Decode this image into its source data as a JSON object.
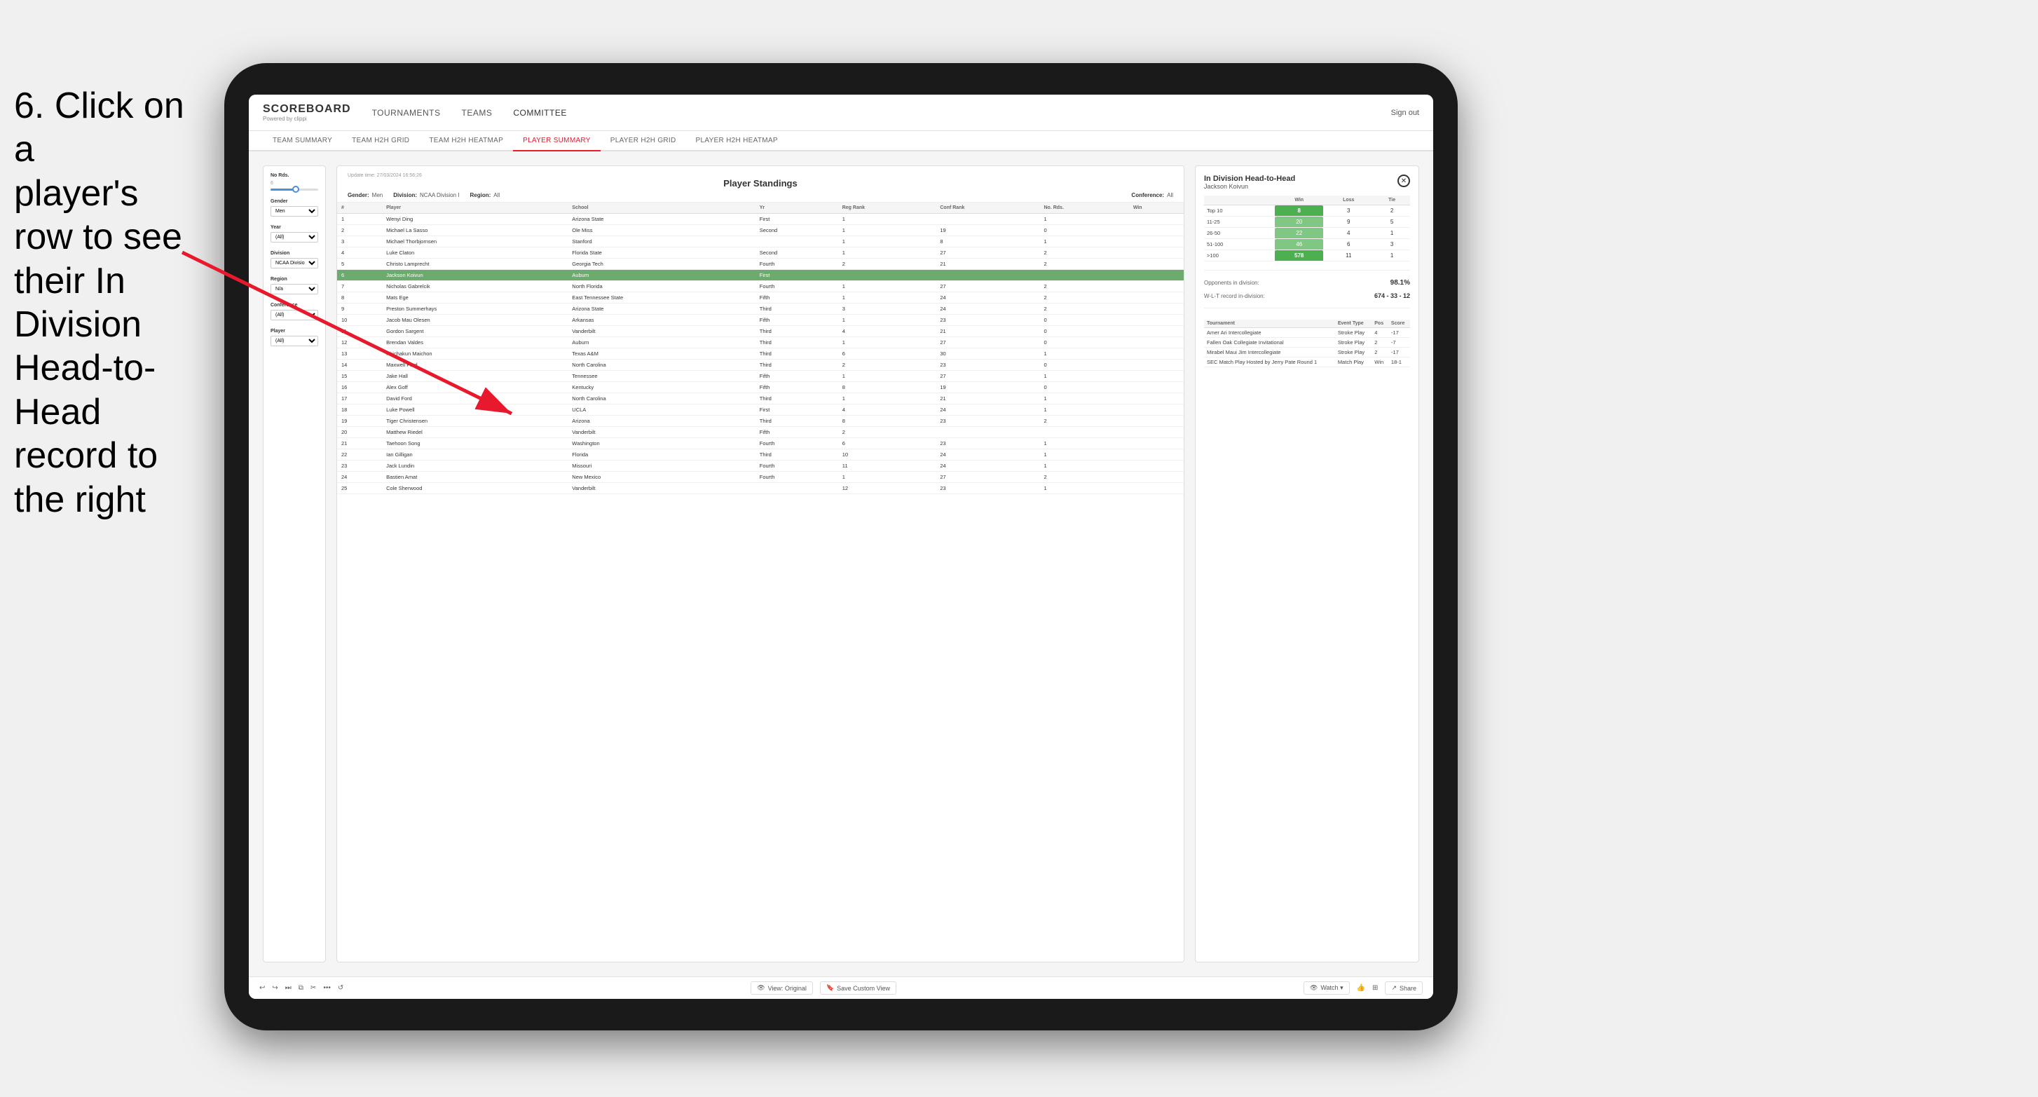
{
  "instruction": {
    "line1": "6. Click on a",
    "line2": "player's row to see",
    "line3": "their In Division",
    "line4": "Head-to-Head",
    "line5": "record to the right"
  },
  "nav": {
    "logo": "SCOREBOARD",
    "logo_sub": "Powered by clippi",
    "items": [
      "TOURNAMENTS",
      "TEAMS",
      "COMMITTEE"
    ],
    "sign_out": "Sign out"
  },
  "sub_nav": {
    "items": [
      "TEAM SUMMARY",
      "TEAM H2H GRID",
      "TEAM H2H HEATMAP",
      "PLAYER SUMMARY",
      "PLAYER H2H GRID",
      "PLAYER H2H HEATMAP"
    ],
    "active": "PLAYER SUMMARY"
  },
  "filters": {
    "no_rds_label": "No Rds.",
    "no_rds_value": "6",
    "gender_label": "Gender",
    "gender_value": "Men",
    "year_label": "Year",
    "year_value": "(All)",
    "division_label": "Division",
    "division_value": "NCAA Division I",
    "region_label": "Region",
    "region_value": "N/a",
    "conference_label": "Conference",
    "conference_value": "(All)",
    "player_label": "Player",
    "player_value": "(All)"
  },
  "standings": {
    "title": "Player Standings",
    "update_time": "Update time:",
    "update_date": "27/03/2024 16:56:26",
    "gender_label": "Gender:",
    "gender_value": "Men",
    "division_label": "Division:",
    "division_value": "NCAA Division I",
    "region_label": "Region:",
    "region_value": "All",
    "conference_label": "Conference:",
    "conference_value": "All",
    "columns": [
      "#",
      "Player",
      "School",
      "Yr",
      "Reg Rank",
      "Conf Rank",
      "No. Rds.",
      "Win"
    ],
    "rows": [
      {
        "num": "1",
        "player": "Wenyi Ding",
        "school": "Arizona State",
        "yr": "First",
        "reg": "1",
        "conf": "",
        "rds": "1",
        "win": ""
      },
      {
        "num": "2",
        "player": "Michael La Sasso",
        "school": "Ole Miss",
        "yr": "Second",
        "reg": "1",
        "conf": "19",
        "rds": "0",
        "win": ""
      },
      {
        "num": "3",
        "player": "Michael Thorbjornsen",
        "school": "Stanford",
        "yr": "",
        "reg": "1",
        "conf": "8",
        "rds": "1",
        "win": ""
      },
      {
        "num": "4",
        "player": "Luke Claton",
        "school": "Florida State",
        "yr": "Second",
        "reg": "1",
        "conf": "27",
        "rds": "2",
        "win": ""
      },
      {
        "num": "5",
        "player": "Christo Lamprecht",
        "school": "Georgia Tech",
        "yr": "Fourth",
        "reg": "2",
        "conf": "21",
        "rds": "2",
        "win": ""
      },
      {
        "num": "6",
        "player": "Jackson Koivun",
        "school": "Auburn",
        "yr": "First",
        "reg": "",
        "conf": "",
        "rds": "",
        "win": "",
        "highlighted": true
      },
      {
        "num": "7",
        "player": "Nicholas Gabrelcik",
        "school": "North Florida",
        "yr": "Fourth",
        "reg": "1",
        "conf": "27",
        "rds": "2",
        "win": ""
      },
      {
        "num": "8",
        "player": "Mats Ege",
        "school": "East Tennessee State",
        "yr": "Fifth",
        "reg": "1",
        "conf": "24",
        "rds": "2",
        "win": ""
      },
      {
        "num": "9",
        "player": "Preston Summerhays",
        "school": "Arizona State",
        "yr": "Third",
        "reg": "3",
        "conf": "24",
        "rds": "2",
        "win": ""
      },
      {
        "num": "10",
        "player": "Jacob Mau Olesen",
        "school": "Arkansas",
        "yr": "Fifth",
        "reg": "1",
        "conf": "23",
        "rds": "0",
        "win": ""
      },
      {
        "num": "11",
        "player": "Gordon Sargent",
        "school": "Vanderbilt",
        "yr": "Third",
        "reg": "4",
        "conf": "21",
        "rds": "0",
        "win": ""
      },
      {
        "num": "12",
        "player": "Brendan Valdes",
        "school": "Auburn",
        "yr": "Third",
        "reg": "1",
        "conf": "27",
        "rds": "0",
        "win": ""
      },
      {
        "num": "13",
        "player": "Phichakun Maichon",
        "school": "Texas A&M",
        "yr": "Third",
        "reg": "6",
        "conf": "30",
        "rds": "1",
        "win": ""
      },
      {
        "num": "14",
        "player": "Maxwell Ford",
        "school": "North Carolina",
        "yr": "Third",
        "reg": "2",
        "conf": "23",
        "rds": "0",
        "win": ""
      },
      {
        "num": "15",
        "player": "Jake Hall",
        "school": "Tennessee",
        "yr": "Fifth",
        "reg": "1",
        "conf": "27",
        "rds": "1",
        "win": ""
      },
      {
        "num": "16",
        "player": "Alex Goff",
        "school": "Kentucky",
        "yr": "Fifth",
        "reg": "8",
        "conf": "19",
        "rds": "0",
        "win": ""
      },
      {
        "num": "17",
        "player": "David Ford",
        "school": "North Carolina",
        "yr": "Third",
        "reg": "1",
        "conf": "21",
        "rds": "1",
        "win": ""
      },
      {
        "num": "18",
        "player": "Luke Powell",
        "school": "UCLA",
        "yr": "First",
        "reg": "4",
        "conf": "24",
        "rds": "1",
        "win": ""
      },
      {
        "num": "19",
        "player": "Tiger Christensen",
        "school": "Arizona",
        "yr": "Third",
        "reg": "8",
        "conf": "23",
        "rds": "2",
        "win": ""
      },
      {
        "num": "20",
        "player": "Matthew Riedel",
        "school": "Vanderbilt",
        "yr": "Fifth",
        "reg": "2",
        "conf": "",
        "rds": "",
        "win": ""
      },
      {
        "num": "21",
        "player": "Taehoon Song",
        "school": "Washington",
        "yr": "Fourth",
        "reg": "6",
        "conf": "23",
        "rds": "1",
        "win": ""
      },
      {
        "num": "22",
        "player": "Ian Gilligan",
        "school": "Florida",
        "yr": "Third",
        "reg": "10",
        "conf": "24",
        "rds": "1",
        "win": ""
      },
      {
        "num": "23",
        "player": "Jack Lundin",
        "school": "Missouri",
        "yr": "Fourth",
        "reg": "11",
        "conf": "24",
        "rds": "1",
        "win": ""
      },
      {
        "num": "24",
        "player": "Bastien Amat",
        "school": "New Mexico",
        "yr": "Fourth",
        "reg": "1",
        "conf": "27",
        "rds": "2",
        "win": ""
      },
      {
        "num": "25",
        "player": "Cole Sherwood",
        "school": "Vanderbilt",
        "yr": "",
        "reg": "12",
        "conf": "23",
        "rds": "1",
        "win": ""
      }
    ]
  },
  "h2h": {
    "title": "In Division Head-to-Head",
    "player_name": "Jackson Koivun",
    "table_headers": [
      "",
      "Win",
      "Loss",
      "Tie"
    ],
    "rows": [
      {
        "label": "Top 10",
        "win": "8",
        "loss": "3",
        "tie": "2",
        "win_color": "green"
      },
      {
        "label": "11-25",
        "win": "20",
        "loss": "9",
        "tie": "5",
        "win_color": "light_green"
      },
      {
        "label": "26-50",
        "win": "22",
        "loss": "4",
        "tie": "1",
        "win_color": "light_green"
      },
      {
        "label": "51-100",
        "win": "46",
        "loss": "6",
        "tie": "3",
        "win_color": "light_green"
      },
      {
        "label": ">100",
        "win": "578",
        "loss": "11",
        "tie": "1",
        "win_color": "green"
      }
    ],
    "opponents_label": "Opponents in division:",
    "opponents_pct": "98.1%",
    "record_label": "W-L-T record in-division:",
    "record_value": "674 - 33 - 12",
    "tournament_headers": [
      "Tournament",
      "Event Type",
      "Pos",
      "Score"
    ],
    "tournaments": [
      {
        "name": "Amer Ari Intercollegiate",
        "type": "Stroke Play",
        "pos": "4",
        "score": "-17"
      },
      {
        "name": "Fallen Oak Collegiate Invitational",
        "type": "Stroke Play",
        "pos": "2",
        "score": "-7"
      },
      {
        "name": "Mirabel Maui Jim Intercollegiate",
        "type": "Stroke Play",
        "pos": "2",
        "score": "-17"
      },
      {
        "name": "SEC Match Play Hosted by Jerry Pate Round 1",
        "type": "Match Play",
        "pos": "Win",
        "score": "18-1"
      }
    ]
  },
  "toolbar": {
    "view_original": "View: Original",
    "save_custom": "Save Custom View",
    "watch": "Watch ▾",
    "share": "Share"
  }
}
